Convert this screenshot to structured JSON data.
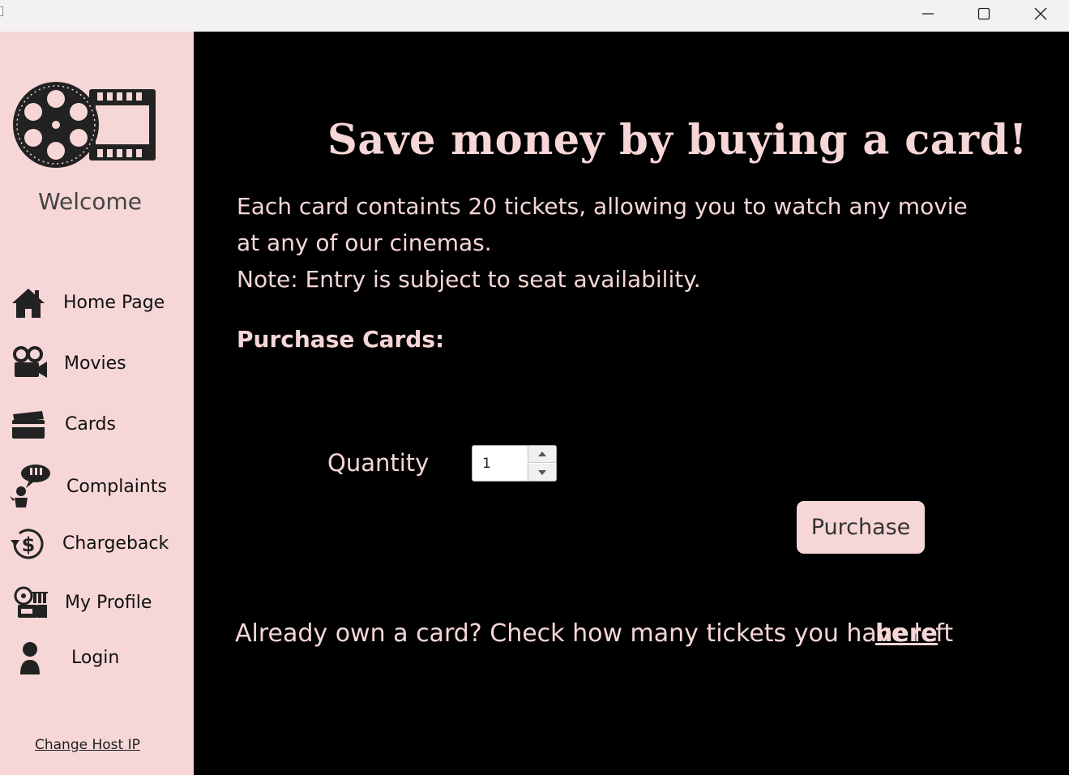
{
  "window": {
    "minimize_icon": "minimize-icon",
    "maximize_icon": "maximize-icon",
    "close_icon": "close-icon"
  },
  "sidebar": {
    "logo_icon": "film-reel-icon",
    "welcome": "Welcome",
    "items": [
      {
        "label": "Home Page",
        "icon": "home-icon"
      },
      {
        "label": "Movies",
        "icon": "movie-camera-icon"
      },
      {
        "label": "Cards",
        "icon": "card-icon"
      },
      {
        "label": "Complaints",
        "icon": "complaint-icon"
      },
      {
        "label": "Chargeback",
        "icon": "chargeback-icon"
      },
      {
        "label": "My Profile",
        "icon": "profile-icon"
      },
      {
        "label": "Login",
        "icon": "user-icon"
      }
    ],
    "change_host": "Change Host IP"
  },
  "main": {
    "title": "Save money by buying a card!",
    "description_lines": [
      "Each card containts 20 tickets, allowing you to watch any movie",
      "at any of our cinemas.",
      "Note: Entry is subject to seat availability."
    ],
    "purchase_heading": "Purchase Cards:",
    "quantity_label": "Quantity",
    "quantity_value": "1",
    "purchase_button": "Purchase",
    "footer_text": "Already own a card? Check how many tickets you have left",
    "footer_link": "here"
  },
  "colors": {
    "sidebar_bg": "#f6d6d6",
    "main_bg": "#000000",
    "accent_text": "#f6d6d6"
  }
}
